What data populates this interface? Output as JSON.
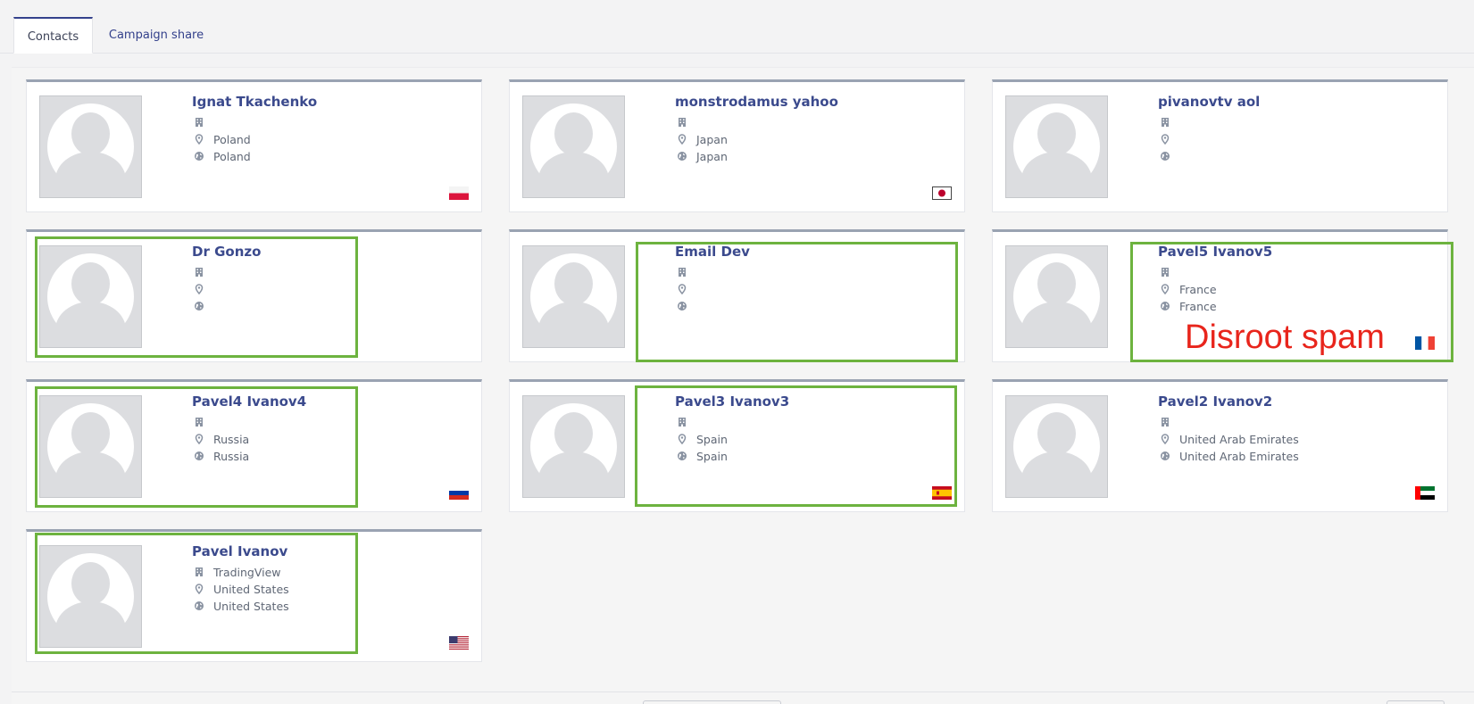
{
  "tabs": [
    {
      "label": "Contacts",
      "active": true
    },
    {
      "label": "Campaign share",
      "active": false
    }
  ],
  "colors": {
    "accent": "#34418c",
    "highlight": "#6db33f",
    "annotation": "#e8251c"
  },
  "annotation": {
    "text": "Disroot spam"
  },
  "contacts": [
    {
      "name": "Ignat Tkachenko",
      "company": "",
      "city": "Poland",
      "country": "Poland",
      "flag": "poland-flag-icon"
    },
    {
      "name": "monstrodamus yahoo",
      "company": "",
      "city": "Japan",
      "country": "Japan",
      "flag": "japan-flag-icon"
    },
    {
      "name": "pivanovtv aol",
      "company": "",
      "city": "",
      "country": "",
      "flag": ""
    },
    {
      "name": "Dr Gonzo",
      "company": "",
      "city": "",
      "country": "",
      "flag": ""
    },
    {
      "name": "Email Dev",
      "company": "",
      "city": "",
      "country": "",
      "flag": ""
    },
    {
      "name": "Pavel5 Ivanov5",
      "company": "",
      "city": "France",
      "country": "France",
      "flag": "france-flag-icon"
    },
    {
      "name": "Pavel4 Ivanov4",
      "company": "",
      "city": "Russia",
      "country": "Russia",
      "flag": "russia-flag-icon"
    },
    {
      "name": "Pavel3 Ivanov3",
      "company": "",
      "city": "Spain",
      "country": "Spain",
      "flag": "spain-flag-icon"
    },
    {
      "name": "Pavel2 Ivanov2",
      "company": "",
      "city": "United Arab Emirates",
      "country": "United Arab Emirates",
      "flag": "uae-flag-icon"
    },
    {
      "name": "Pavel Ivanov",
      "company": "TradingView",
      "city": "United States",
      "country": "United States",
      "flag": "usa-flag-icon"
    }
  ]
}
